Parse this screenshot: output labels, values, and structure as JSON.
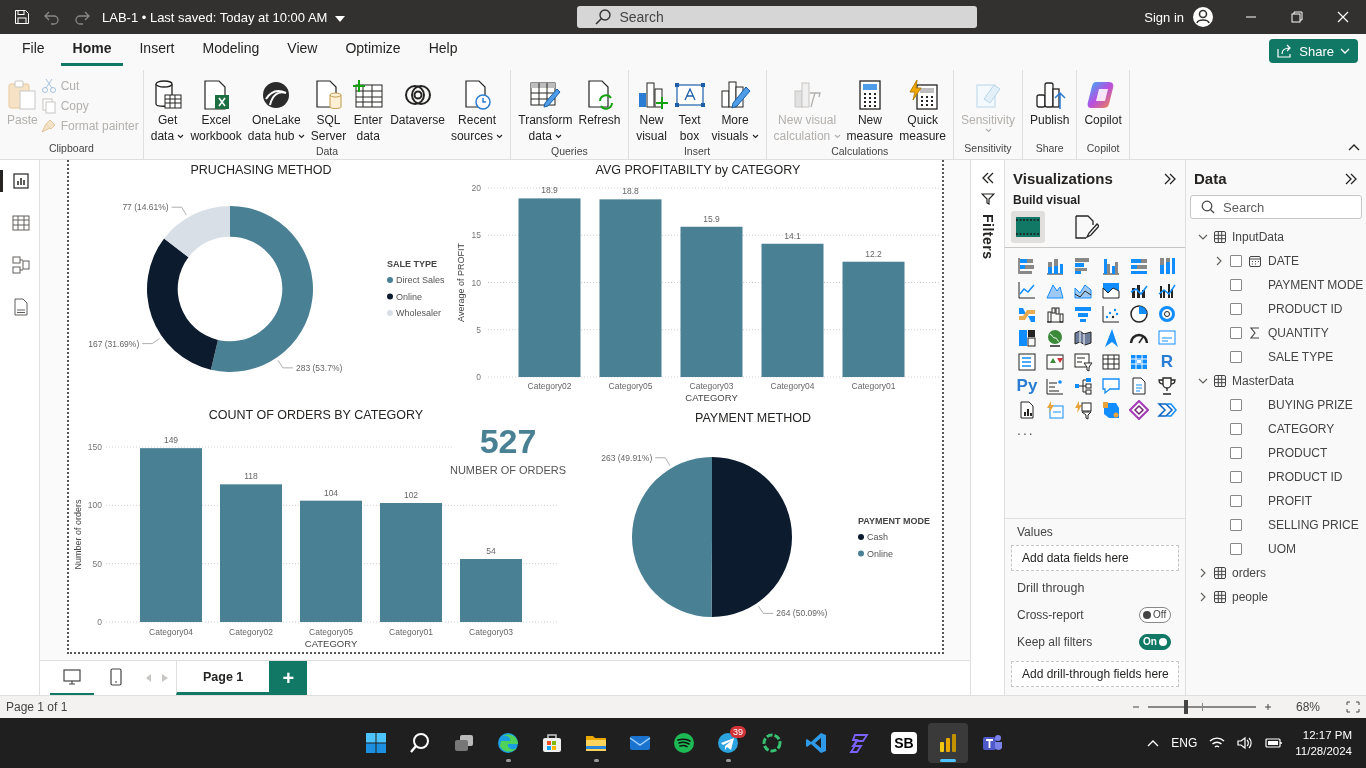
{
  "title_bar": {
    "document": "LAB-1 • Last saved: Today at 10:00 AM",
    "search_placeholder": "Search",
    "sign_in": "Sign in"
  },
  "menu_tabs": [
    {
      "label": "File",
      "selected": false
    },
    {
      "label": "Home",
      "selected": true
    },
    {
      "label": "Insert",
      "selected": false
    },
    {
      "label": "Modeling",
      "selected": false
    },
    {
      "label": "View",
      "selected": false
    },
    {
      "label": "Optimize",
      "selected": false
    },
    {
      "label": "Help",
      "selected": false
    }
  ],
  "share_button": "Share",
  "ribbon_groups": [
    {
      "name": "Clipboard",
      "buttons": [
        {
          "kind": "large",
          "label": [
            "Paste"
          ],
          "disabled": true,
          "dropdown": false
        },
        {
          "kind": "small",
          "label": [
            "Cut"
          ],
          "disabled": true,
          "dropdown": false
        },
        {
          "kind": "small",
          "label": [
            "Copy"
          ],
          "disabled": true,
          "dropdown": false
        },
        {
          "kind": "small",
          "label": [
            "Format painter"
          ],
          "disabled": true,
          "dropdown": false
        }
      ]
    },
    {
      "name": "Data",
      "buttons": [
        {
          "kind": "large",
          "label": [
            "Get",
            "data"
          ],
          "disabled": false,
          "dropdown": true
        },
        {
          "kind": "large",
          "label": [
            "Excel",
            "workbook"
          ],
          "disabled": false,
          "dropdown": false
        },
        {
          "kind": "large",
          "label": [
            "OneLake",
            "data hub"
          ],
          "disabled": false,
          "dropdown": true
        },
        {
          "kind": "large",
          "label": [
            "SQL",
            "Server"
          ],
          "disabled": false,
          "dropdown": false
        },
        {
          "kind": "large",
          "label": [
            "Enter",
            "data"
          ],
          "disabled": false,
          "dropdown": false
        },
        {
          "kind": "large",
          "label": [
            "Dataverse"
          ],
          "disabled": false,
          "dropdown": false
        },
        {
          "kind": "large",
          "label": [
            "Recent",
            "sources"
          ],
          "disabled": false,
          "dropdown": true
        }
      ]
    },
    {
      "name": "Queries",
      "buttons": [
        {
          "kind": "large",
          "label": [
            "Transform",
            "data"
          ],
          "disabled": false,
          "dropdown": true
        },
        {
          "kind": "large",
          "label": [
            "Refresh"
          ],
          "disabled": false,
          "dropdown": false
        }
      ]
    },
    {
      "name": "Insert",
      "buttons": [
        {
          "kind": "large",
          "label": [
            "New",
            "visual"
          ],
          "disabled": false,
          "dropdown": false
        },
        {
          "kind": "large",
          "label": [
            "Text",
            "box"
          ],
          "disabled": false,
          "dropdown": false
        },
        {
          "kind": "large",
          "label": [
            "More",
            "visuals"
          ],
          "disabled": false,
          "dropdown": true
        }
      ]
    },
    {
      "name": "Calculations",
      "buttons": [
        {
          "kind": "large",
          "label": [
            "New visual",
            "calculation"
          ],
          "disabled": true,
          "dropdown": true
        },
        {
          "kind": "large",
          "label": [
            "New",
            "measure"
          ],
          "disabled": false,
          "dropdown": false
        },
        {
          "kind": "large",
          "label": [
            "Quick",
            "measure"
          ],
          "disabled": false,
          "dropdown": false
        }
      ]
    },
    {
      "name": "Sensitivity",
      "buttons": [
        {
          "kind": "large",
          "label": [
            "Sensitivity"
          ],
          "disabled": true,
          "dropdown": true
        }
      ]
    },
    {
      "name": "Share",
      "buttons": [
        {
          "kind": "large",
          "label": [
            "Publish"
          ],
          "disabled": false,
          "dropdown": false
        }
      ]
    },
    {
      "name": "Copilot",
      "buttons": [
        {
          "kind": "large",
          "label": [
            "Copilot"
          ],
          "disabled": false,
          "dropdown": false
        }
      ]
    }
  ],
  "report_views": [
    {
      "kind": "report",
      "selected": true
    },
    {
      "kind": "table",
      "selected": false
    },
    {
      "kind": "model",
      "selected": false
    },
    {
      "kind": "dax",
      "selected": false
    }
  ],
  "purchasing_chart": {
    "chart_data": {
      "type": "donut",
      "title": "PRUCHASING METHOD",
      "categories": [
        "Direct Sales",
        "Online",
        "Wholesaler"
      ],
      "colors": [
        "#4a8094",
        "#0c1b2e",
        "#d9dfe6"
      ],
      "series": [
        {
          "name": "SALE TYPE",
          "values": [
            53.7,
            31.69,
            14.61
          ]
        }
      ],
      "value_labels": [
        "283 (53.7%)",
        "167 (31.69%)",
        "77 (14.61%)"
      ],
      "legend": true
    }
  },
  "profit_chart": {
    "chart_data": {
      "type": "bar",
      "title": "AVG PROFITABILTY by CATEGORY",
      "xlabel": "CATEGORY",
      "ylabel": "Average of PROFIT",
      "categories": [
        "Category02",
        "Category05",
        "Category03",
        "Category04",
        "Category01"
      ],
      "series": [
        {
          "color": "#4a8094",
          "values": [
            18.9,
            18.8,
            15.9,
            14.1,
            12.2
          ]
        }
      ],
      "ylim": [
        0,
        20
      ],
      "yticks": [
        0,
        5,
        10,
        15,
        20
      ],
      "grid": true,
      "data_labels": true
    }
  },
  "orders_chart": {
    "chart_data": {
      "type": "bar",
      "title": "COUNT OF ORDERS BY CATEGORY",
      "xlabel": "CATEGORY",
      "ylabel": "Number of orders",
      "categories": [
        "Category04",
        "Category02",
        "Category05",
        "Category01",
        "Category03"
      ],
      "series": [
        {
          "color": "#4a8094",
          "values": [
            149,
            118,
            104,
            102,
            54
          ]
        }
      ],
      "ylim": [
        0,
        150
      ],
      "yticks": [
        0,
        50,
        100,
        150
      ],
      "grid": true,
      "data_labels": true
    }
  },
  "orders_card": {
    "value": "527",
    "label": "NUMBER OF ORDERS"
  },
  "payment_chart": {
    "chart_data": {
      "type": "pie",
      "title": "PAYMENT METHOD",
      "categories": [
        "Cash",
        "Online"
      ],
      "colors": [
        "#0c1b2e",
        "#4a8094"
      ],
      "series": [
        {
          "name": "PAYMENT MODE",
          "values": [
            50.09,
            49.91
          ]
        }
      ],
      "value_labels": [
        "264 (50.09%)",
        "263 (49.91%)"
      ],
      "legend": true
    }
  },
  "page_tabs": {
    "views": [
      {
        "kind": "desktop",
        "selected": true
      },
      {
        "kind": "mobile",
        "selected": false
      }
    ],
    "pages": [
      {
        "label": "Page 1",
        "selected": true
      }
    ],
    "add_label": "+"
  },
  "filters_pane": {
    "label": "Filters"
  },
  "visualizations_pane": {
    "title": "Visualizations",
    "subtitle": "Build visual",
    "modes": [
      {
        "kind": "build",
        "selected": true
      },
      {
        "kind": "format",
        "selected": false
      }
    ],
    "gallery": [
      {
        "kind": "stacked-bar"
      },
      {
        "kind": "stacked-column"
      },
      {
        "kind": "clustered-bar"
      },
      {
        "kind": "clustered-column"
      },
      {
        "kind": "percent-bar"
      },
      {
        "kind": "percent-column"
      },
      {
        "kind": "line"
      },
      {
        "kind": "area"
      },
      {
        "kind": "stacked-area"
      },
      {
        "kind": "percent-area"
      },
      {
        "kind": "line-column"
      },
      {
        "kind": "line-clustered"
      },
      {
        "kind": "ribbon"
      },
      {
        "kind": "waterfall"
      },
      {
        "kind": "funnel"
      },
      {
        "kind": "scatter"
      },
      {
        "kind": "pie"
      },
      {
        "kind": "donut"
      },
      {
        "kind": "treemap"
      },
      {
        "kind": "globe"
      },
      {
        "kind": "filled-map"
      },
      {
        "kind": "navigation"
      },
      {
        "kind": "gauge"
      },
      {
        "kind": "card"
      },
      {
        "kind": "multi-row"
      },
      {
        "kind": "kpi"
      },
      {
        "kind": "slicer"
      },
      {
        "kind": "table"
      },
      {
        "kind": "matrix"
      },
      {
        "kind": "script",
        "label": "R"
      },
      {
        "kind": "script",
        "label": "Py"
      },
      {
        "kind": "influencers"
      },
      {
        "kind": "tree"
      },
      {
        "kind": "speech"
      },
      {
        "kind": "narrative"
      },
      {
        "kind": "trophy"
      },
      {
        "kind": "paginated"
      },
      {
        "kind": "metric-card"
      },
      {
        "kind": "metric-slicer"
      },
      {
        "kind": "shape-map"
      },
      {
        "kind": "diamond"
      },
      {
        "kind": "chevrons"
      }
    ],
    "more": "...",
    "values_label": "Values",
    "values_placeholder": "Add data fields here",
    "drill_title": "Drill through",
    "toggles": [
      {
        "label": "Cross-report",
        "on": false,
        "state_text": "Off"
      },
      {
        "label": "Keep all filters",
        "on": true,
        "state_text": "On"
      }
    ],
    "drill_placeholder": "Add drill-through fields here"
  },
  "data_pane": {
    "title": "Data",
    "search_placeholder": "Search",
    "tables": [
      {
        "name": "InputData",
        "expanded": true,
        "children": [
          {
            "name": "DATE",
            "kind": "date",
            "expanded": false,
            "checked": false
          },
          {
            "name": "PAYMENT MODE",
            "kind": "text",
            "checked": false
          },
          {
            "name": "PRODUCT ID",
            "kind": "text",
            "checked": false
          },
          {
            "name": "QUANTITY",
            "kind": "sum",
            "checked": false
          },
          {
            "name": "SALE TYPE",
            "kind": "text",
            "checked": false
          }
        ]
      },
      {
        "name": "MasterData",
        "expanded": true,
        "children": [
          {
            "name": "BUYING PRIZE",
            "kind": "text",
            "checked": false
          },
          {
            "name": "CATEGORY",
            "kind": "text",
            "checked": false
          },
          {
            "name": "PRODUCT",
            "kind": "text",
            "checked": false
          },
          {
            "name": "PRODUCT ID",
            "kind": "text",
            "checked": false
          },
          {
            "name": "PROFIT",
            "kind": "text",
            "checked": false
          },
          {
            "name": "SELLING PRICE",
            "kind": "text",
            "checked": false
          },
          {
            "name": "UOM",
            "kind": "text",
            "checked": false
          }
        ]
      },
      {
        "name": "orders",
        "expanded": false
      },
      {
        "name": "people",
        "expanded": false
      }
    ]
  },
  "status_bar": {
    "page_info": "Page 1 of 1",
    "zoom": {
      "level": 0.35,
      "reading": "68%"
    }
  },
  "taskbar": {
    "apps": [
      {
        "kind": "start",
        "running": false,
        "active": false
      },
      {
        "kind": "search",
        "running": false,
        "active": false
      },
      {
        "kind": "task-view",
        "running": false,
        "active": false
      },
      {
        "kind": "edge",
        "running": true,
        "active": false
      },
      {
        "kind": "store",
        "running": false,
        "active": false
      },
      {
        "kind": "folder",
        "running": true,
        "active": false
      },
      {
        "kind": "mail",
        "running": false,
        "active": false
      },
      {
        "kind": "spotify",
        "running": false,
        "active": false
      },
      {
        "kind": "telegram",
        "running": true,
        "active": false,
        "badge": "39"
      },
      {
        "kind": "ring",
        "running": false,
        "active": false
      },
      {
        "kind": "vscode",
        "running": false,
        "active": false
      },
      {
        "kind": "purple",
        "running": false,
        "active": false
      },
      {
        "kind": "label",
        "label": "SB",
        "running": false,
        "active": false
      },
      {
        "kind": "powerbi",
        "running": true,
        "active": true
      },
      {
        "kind": "teams",
        "running": false,
        "active": false
      }
    ],
    "language": "ENG",
    "time": "12:17 PM",
    "date": "11/28/2024"
  }
}
